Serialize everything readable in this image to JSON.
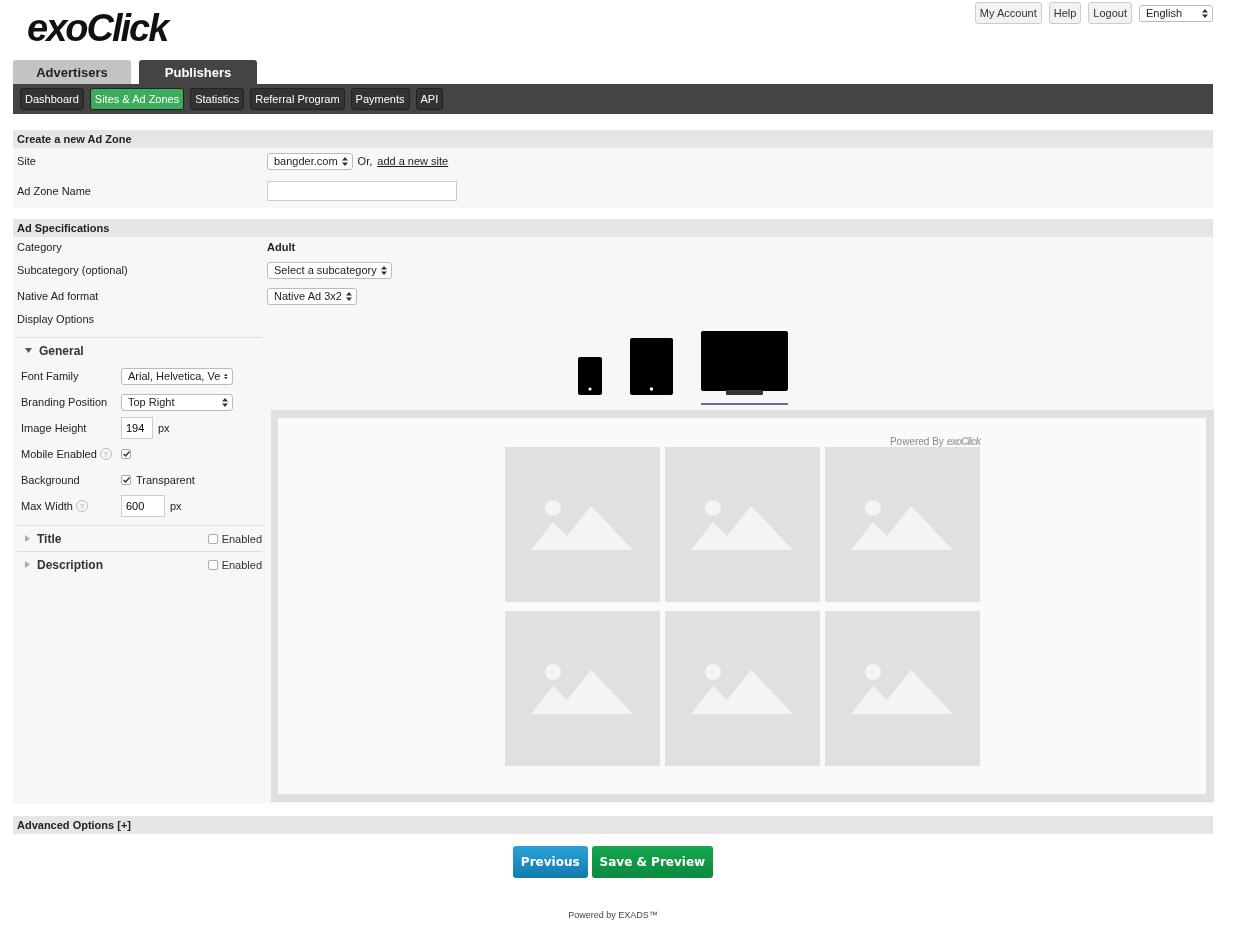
{
  "logo": {
    "text": "exoClick"
  },
  "top_links": [
    "My Account",
    "Help",
    "Logout"
  ],
  "language": {
    "value": "English"
  },
  "tabs": [
    {
      "label": "Advertisers",
      "selected": false
    },
    {
      "label": "Publishers",
      "selected": true
    }
  ],
  "subnav": [
    {
      "label": "Dashboard",
      "selected": false
    },
    {
      "label": "Sites & Ad Zones",
      "selected": true
    },
    {
      "label": "Statistics",
      "selected": false
    },
    {
      "label": "Referral Program",
      "selected": false
    },
    {
      "label": "Payments",
      "selected": false
    },
    {
      "label": "API",
      "selected": false
    }
  ],
  "create_section": {
    "title": "Create a new Ad Zone",
    "site": {
      "label": "Site",
      "value": "bangder.com",
      "or_text": "Or,",
      "link": "add a new site"
    },
    "zone_name": {
      "label": "Ad Zone Name"
    }
  },
  "spec_section": {
    "title": "Ad Specifications",
    "category": {
      "label": "Category",
      "value": "Adult"
    },
    "subcategory": {
      "label": "Subcategory (optional)",
      "value": "Select a subcategory"
    },
    "format": {
      "label": "Native Ad format",
      "value": "Native Ad 3x2"
    },
    "display_options_label": "Display Options"
  },
  "panels": [
    {
      "title": "General",
      "expanded": true,
      "fields": [
        {
          "kind": "select",
          "label": "Font Family",
          "value": "Arial, Helvetica, Ve"
        },
        {
          "kind": "select",
          "label": "Branding Position",
          "value": "Top Right"
        },
        {
          "kind": "number",
          "label": "Image Height",
          "value": "194",
          "unit": "px"
        },
        {
          "kind": "checkbox",
          "label": "Mobile Enabled",
          "help": "?",
          "checked": true
        },
        {
          "kind": "checkbox",
          "label": "Background",
          "checked": true,
          "text": "Transparent"
        },
        {
          "kind": "number",
          "label": "Max Width",
          "help": "?",
          "value": "600",
          "unit": "px"
        }
      ]
    },
    {
      "title": "Title",
      "expanded": false,
      "enabled": {
        "label": "Enabled",
        "checked": false
      }
    },
    {
      "title": "Description",
      "expanded": false,
      "enabled": {
        "label": "Enabled",
        "checked": false
      }
    }
  ],
  "devices": [
    {
      "kind": "phone",
      "selected": false
    },
    {
      "kind": "tablet",
      "selected": false
    },
    {
      "kind": "desktop",
      "selected": true
    }
  ],
  "preview": {
    "powered_by": "Powered By",
    "brand": "exoClick",
    "tiles": [
      {
        "kind": "image_placeholder"
      },
      {
        "kind": "image_placeholder"
      },
      {
        "kind": "image_placeholder"
      },
      {
        "kind": "image_placeholder"
      },
      {
        "kind": "image_placeholder"
      },
      {
        "kind": "image_placeholder"
      }
    ]
  },
  "advanced": {
    "title": "Advanced Options [+]"
  },
  "buttons": [
    {
      "label": "Previous",
      "kind": "secondary"
    },
    {
      "label": "Save & Preview",
      "kind": "primary"
    }
  ],
  "footer": "Powered by EXADS™"
}
